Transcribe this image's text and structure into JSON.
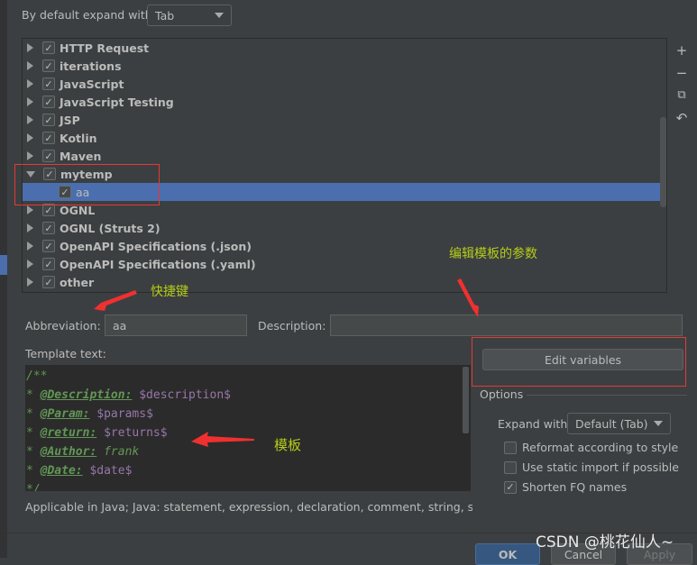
{
  "expand_default": {
    "label": "By default expand with",
    "value": "Tab"
  },
  "tree": [
    {
      "label": "HTTP Request",
      "checked": true,
      "expanded": false
    },
    {
      "label": "iterations",
      "checked": true,
      "expanded": false
    },
    {
      "label": "JavaScript",
      "checked": true,
      "expanded": false
    },
    {
      "label": "JavaScript Testing",
      "checked": true,
      "expanded": false
    },
    {
      "label": "JSP",
      "checked": true,
      "expanded": false
    },
    {
      "label": "Kotlin",
      "checked": true,
      "expanded": false
    },
    {
      "label": "Maven",
      "checked": true,
      "expanded": false
    },
    {
      "label": "mytemp",
      "checked": true,
      "expanded": true
    },
    {
      "label": "aa",
      "checked": true,
      "child": true,
      "selected": true
    },
    {
      "label": "OGNL",
      "checked": true,
      "expanded": false
    },
    {
      "label": "OGNL (Struts 2)",
      "checked": true,
      "expanded": false
    },
    {
      "label": "OpenAPI Specifications (.json)",
      "checked": true,
      "expanded": false
    },
    {
      "label": "OpenAPI Specifications (.yaml)",
      "checked": true,
      "expanded": false
    },
    {
      "label": "other",
      "checked": true,
      "expanded": false
    }
  ],
  "toolbar": {
    "add": "+",
    "remove": "−",
    "copy": "⧉",
    "restore": "↶"
  },
  "abbreviation": {
    "label": "Abbreviation:",
    "value": "aa"
  },
  "description": {
    "label": "Description:",
    "value": ""
  },
  "template": {
    "label": "Template text:",
    "lines": [
      [
        {
          "t": "/**",
          "c": "cm"
        }
      ],
      [
        {
          "t": "* ",
          "c": "cm"
        },
        {
          "t": "@Description:",
          "c": "tag"
        },
        {
          "t": " ",
          "c": "cm"
        },
        {
          "t": "$description$",
          "c": "var"
        }
      ],
      [
        {
          "t": "* ",
          "c": "cm"
        },
        {
          "t": "@Param:",
          "c": "tag"
        },
        {
          "t": " ",
          "c": "cm"
        },
        {
          "t": "$params$",
          "c": "var"
        }
      ],
      [
        {
          "t": "* ",
          "c": "cm"
        },
        {
          "t": "@return:",
          "c": "tag"
        },
        {
          "t": " ",
          "c": "cm"
        },
        {
          "t": "$returns$",
          "c": "var"
        }
      ],
      [
        {
          "t": "* ",
          "c": "cm"
        },
        {
          "t": "@Author:",
          "c": "tag"
        },
        {
          "t": " frank",
          "c": "cm"
        }
      ],
      [
        {
          "t": "* ",
          "c": "cm"
        },
        {
          "t": "@Date:",
          "c": "tag"
        },
        {
          "t": " ",
          "c": "cm"
        },
        {
          "t": "$date$",
          "c": "var"
        }
      ],
      [
        {
          "t": "*/",
          "c": "cm"
        }
      ]
    ]
  },
  "applicable": "Applicable in Java; Java: statement, expression, declaration, comment, string, smart ty",
  "edit_variables": "Edit variables",
  "options": {
    "title": "Options",
    "expand_label": "Expand with",
    "expand_value": "Default (Tab)",
    "checks": [
      {
        "label": "Reformat according to style",
        "checked": false
      },
      {
        "label": "Use static import if possible",
        "checked": false
      },
      {
        "label": "Shorten FQ names",
        "checked": true
      }
    ]
  },
  "buttons": {
    "ok": "OK",
    "cancel": "Cancel",
    "apply": "Apply"
  },
  "annotations": {
    "shortcut": "快捷键",
    "edit_params": "编辑模板的参数",
    "template": "模板"
  },
  "watermark": "CSDN @桃花仙人~",
  "colors": {
    "selection": "#4b6eaf",
    "annotation": "#b5cc18",
    "highlight_box": "#e53935",
    "ok_button": "#365880"
  }
}
